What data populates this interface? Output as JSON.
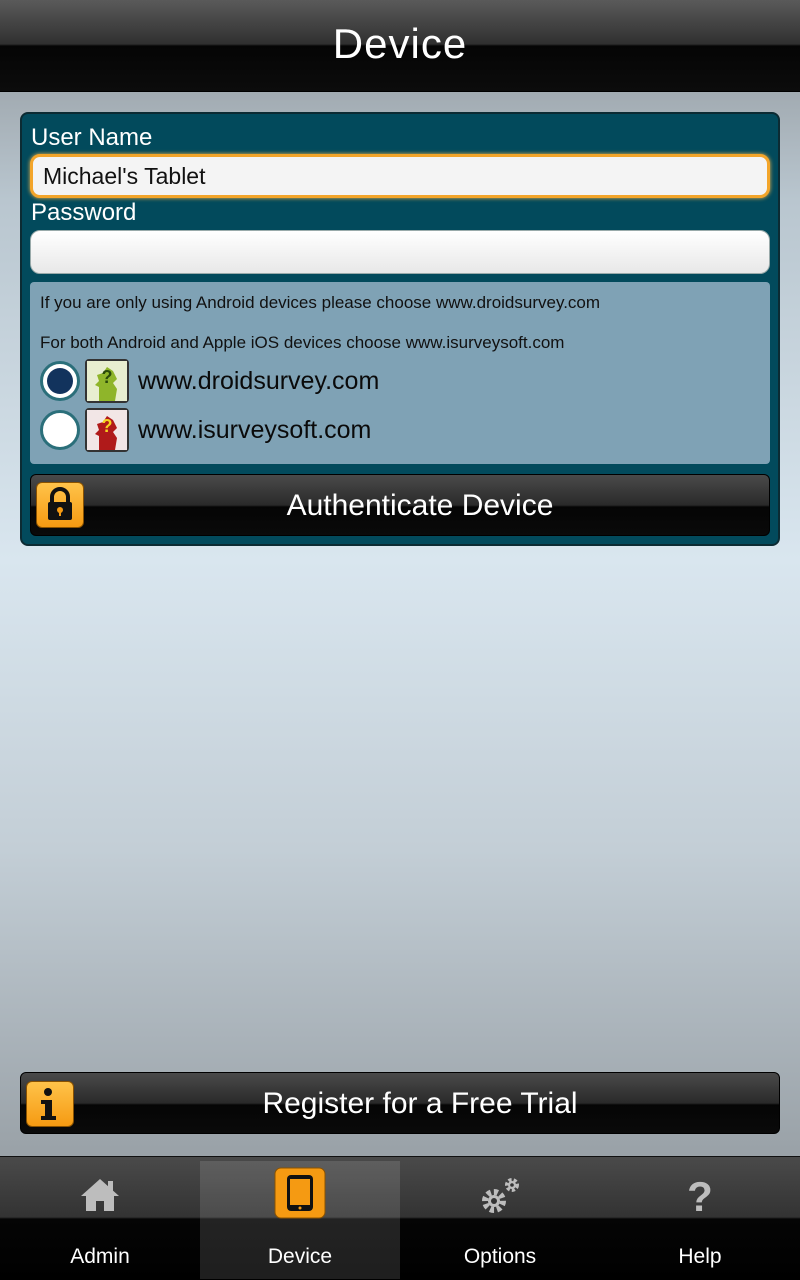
{
  "header": {
    "title": "Device"
  },
  "form": {
    "username_label": "User Name",
    "username_value": "Michael's Tablet",
    "password_label": "Password",
    "password_value": ""
  },
  "info": {
    "android_msg": "If you are only using Android devices please choose www.droidsurvey.com",
    "both_msg": "For both Android and Apple iOS devices choose www.isurveysoft.com"
  },
  "server_options": [
    {
      "label": "www.droidsurvey.com",
      "selected": true,
      "icon": "droidsurvey-logo-icon",
      "color": "#8fb52a"
    },
    {
      "label": "www.isurveysoft.com",
      "selected": false,
      "icon": "isurveysoft-logo-icon",
      "color": "#b01a1a"
    }
  ],
  "authenticate_button": {
    "label": "Authenticate Device",
    "icon": "lock-icon"
  },
  "register_button": {
    "label": "Register for a Free Trial",
    "icon": "info-icon"
  },
  "tabs": [
    {
      "label": "Admin",
      "icon": "home-icon",
      "selected": false
    },
    {
      "label": "Device",
      "icon": "tablet-icon",
      "selected": true
    },
    {
      "label": "Options",
      "icon": "gears-icon",
      "selected": false
    },
    {
      "label": "Help",
      "icon": "question-icon",
      "selected": false
    }
  ],
  "colors": {
    "panel": "#024a5c",
    "accent": "#f59a12",
    "info_box": "#7fa2b5"
  }
}
